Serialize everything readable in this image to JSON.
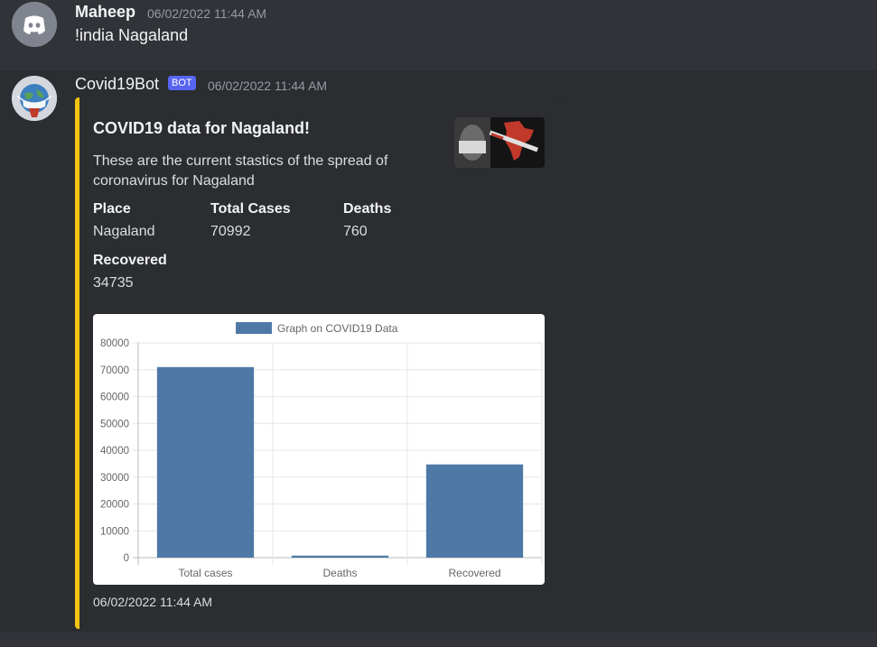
{
  "messages": [
    {
      "username": "Maheep",
      "timestamp": "06/02/2022 11:44 AM",
      "text": "!india Nagaland",
      "avatar_icon": "discord-logo-icon"
    },
    {
      "username": "Covid19Bot",
      "badge": "BOT",
      "timestamp": "06/02/2022 11:44 AM",
      "avatar_icon": "globe-mask-icon",
      "embed": {
        "accent_color": "#f1c40f",
        "title": "COVID19 data for Nagaland!",
        "description": "These are the current stastics of the spread of coronavirus for Nagaland",
        "fields": [
          {
            "name": "Place",
            "value": "Nagaland"
          },
          {
            "name": "Total Cases",
            "value": "70992"
          },
          {
            "name": "Deaths",
            "value": "760"
          },
          {
            "name": "Recovered",
            "value": "34735"
          }
        ],
        "footer_timestamp": "06/02/2022 11:44 AM"
      }
    }
  ],
  "chart_data": {
    "type": "bar",
    "categories": [
      "Total cases",
      "Deaths",
      "Recovered"
    ],
    "series": [
      {
        "name": "Graph on COVID19 Data",
        "values": [
          70992,
          760,
          34735
        ]
      }
    ],
    "ylim": [
      0,
      80000
    ],
    "yticks": [
      "80000",
      "70000",
      "60000",
      "50000",
      "40000",
      "30000",
      "20000",
      "10000",
      "0"
    ],
    "grid": true,
    "legend": "top",
    "bar_color": "#4e79a7"
  }
}
